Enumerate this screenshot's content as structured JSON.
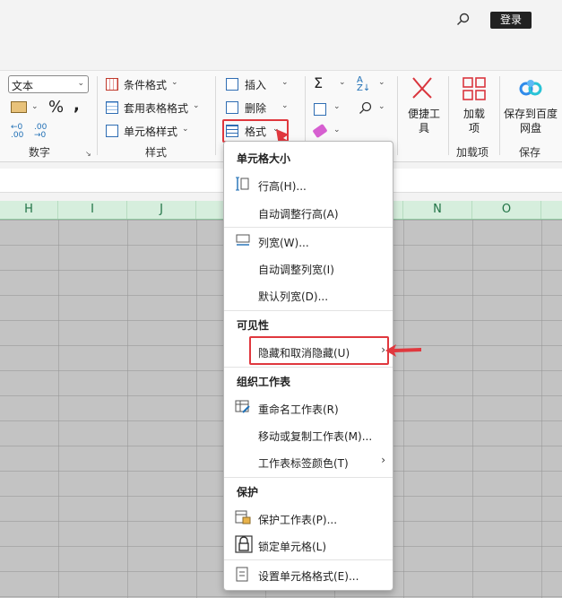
{
  "titlebar": {
    "login_label": "登录"
  },
  "ribbon": {
    "number_format_value": "文本",
    "group_number_label": "数字",
    "conditional_format": "条件格式",
    "table_format": "套用表格格式",
    "cell_style": "单元格样式",
    "group_style_label": "样式",
    "insert": "插入",
    "delete": "删除",
    "format": "格式",
    "quick_tools": "便捷工具",
    "addins": "加载项",
    "group_addins_label": "加载项",
    "save_baidu": "保存到百度网盘",
    "group_save_label": "保存"
  },
  "columns": [
    "H",
    "I",
    "J",
    "N",
    "O"
  ],
  "menu": {
    "cell_size_header": "单元格大小",
    "row_height": "行高(H)...",
    "autofit_row": "自动调整行高(A)",
    "col_width": "列宽(W)...",
    "autofit_col": "自动调整列宽(I)",
    "default_width": "默认列宽(D)...",
    "visibility_header": "可见性",
    "hide_unhide": "隐藏和取消隐藏(U)",
    "organize_header": "组织工作表",
    "rename_sheet": "重命名工作表(R)",
    "move_copy": "移动或复制工作表(M)...",
    "tab_color": "工作表标签颜色(T)",
    "protect_header": "保护",
    "protect_sheet": "保护工作表(P)...",
    "lock_cell": "锁定单元格(L)",
    "format_cells": "设置单元格格式(E)..."
  },
  "colors": {
    "annotation_red": "#e0383e",
    "header_green": "#217346",
    "grid_gray": "#c3c3c3"
  }
}
